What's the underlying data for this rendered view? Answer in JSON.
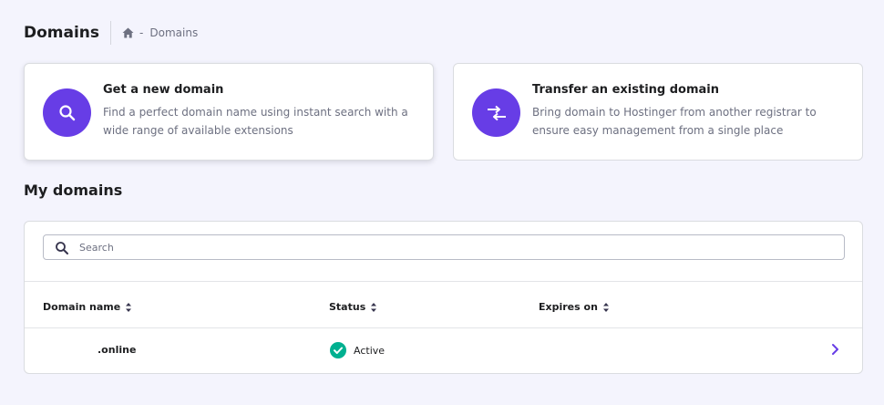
{
  "header": {
    "title": "Domains",
    "breadcrumb": {
      "home_icon": "home-icon",
      "separator": "-",
      "current": "Domains"
    }
  },
  "cards": [
    {
      "icon": "search-icon",
      "title": "Get a new domain",
      "description": "Find a perfect domain name using instant search with a wide range of available extensions"
    },
    {
      "icon": "transfer-arrows-icon",
      "title": "Transfer an existing domain",
      "description": "Bring domain to Hostinger from another registrar to ensure easy management from a single place"
    }
  ],
  "my_domains": {
    "title": "My domains",
    "search": {
      "placeholder": "Search",
      "value": ""
    },
    "columns": [
      "Domain name",
      "Status",
      "Expires on"
    ],
    "rows": [
      {
        "domain": ".online",
        "status": "Active",
        "expires": ""
      }
    ]
  },
  "colors": {
    "accent": "#673de6",
    "active_status": "#00b090",
    "background": "#f4f4fd"
  }
}
